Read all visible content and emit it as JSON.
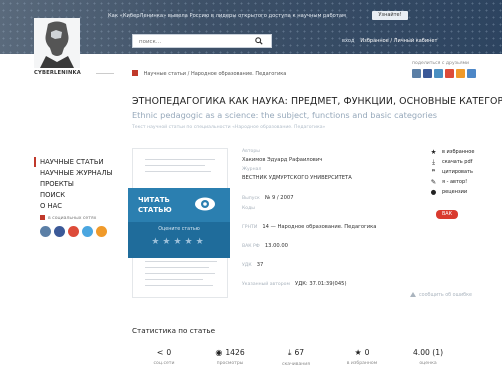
{
  "header": {
    "announcement": "Как «КиберЛенинка» вывела Россию в лидеры открытого доступа к научным работам",
    "more_button": "Узнайте!",
    "search_placeholder": "поиск...",
    "login_label": "вход",
    "account_label": "Избранное / Личный кабинет"
  },
  "logo": {
    "text": "CYBERLENINKA"
  },
  "breadcrumb": {
    "items": [
      "Научные статьи",
      "Народное образование. Педагогика"
    ]
  },
  "share": {
    "label": "поделиться с друзьями"
  },
  "article": {
    "title": "ЭТНОПЕДАГОГИКА КАК НАУКА: ПРЕДМЕТ, ФУНКЦИИ, ОСНОВНЫЕ КАТЕГОРИИ",
    "subtitle": "Ethnic pedagogic as a science: the subject, functions and basic categories",
    "subject_line": "Текст научной статьи по специальности «Народное образование. Педагогика»"
  },
  "nav": {
    "items": [
      "НАУЧНЫЕ СТАТЬИ",
      "НАУЧНЫЕ ЖУРНАЛЫ",
      "ПРОЕКТЫ",
      "ПОИСК",
      "О НАС"
    ]
  },
  "social": {
    "label": "в социальных сетях"
  },
  "reader": {
    "read_label_1": "ЧИТАТЬ",
    "read_label_2": "СТАТЬЮ",
    "rate_label": "Оцените статью",
    "stars": "★★★★★"
  },
  "meta": {
    "author_label": "Авторы",
    "author": "Хакимов Эдуард Рафаилович",
    "journal_label": "Журнал",
    "journal": "ВЕСТНИК УДМУРТСКОГО УНИВЕРСИТЕТА",
    "issue_label": "Выпуск",
    "issue": "№ 9 / 2007",
    "codes_label": "Коды",
    "grnti_label": "ГРНТИ",
    "grnti": "14 — Народное образование. Педагогика",
    "vak_label": "ВАК РФ",
    "vak": "13.00.00",
    "udk_label": "УДК",
    "udk": "37",
    "udk_author_label": "Указанный автором",
    "udk_author": "УДК: 37.01:39(045)"
  },
  "actions": {
    "items": [
      "в избранное",
      "скачать pdf",
      "цитировать",
      "я - автор!",
      "рецензии"
    ],
    "vak_badge": "ВАК"
  },
  "report": {
    "label": "сообщить об ошибке"
  },
  "stats": {
    "title": "Статистика по статье",
    "items": [
      {
        "value": "0",
        "caption": "соц.сети"
      },
      {
        "value": "1426",
        "caption": "просмотры"
      },
      {
        "value": "67",
        "caption": "скачивания"
      },
      {
        "value": "0",
        "caption": "в избранном"
      },
      {
        "value": "4.00 (1)",
        "caption": "оценка"
      }
    ]
  },
  "colors": {
    "accent_red": "#c0392b",
    "reader_blue": "#2b7fb0",
    "header_dark": "#2d4460"
  }
}
